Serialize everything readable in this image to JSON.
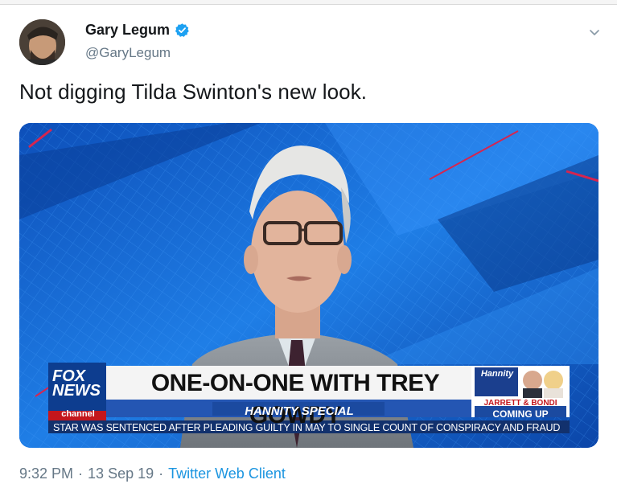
{
  "tweet": {
    "display_name": "Gary Legum",
    "handle": "@GaryLegum",
    "text": "Not digging Tilda Swinton's new look.",
    "time": "9:32 PM",
    "date": "13 Sep 19",
    "client": "Twitter Web Client",
    "separator": "·"
  },
  "icons": {
    "verified": "verified-badge-icon",
    "caret": "chevron-down-icon"
  },
  "media": {
    "network": "FOX NEWS",
    "network_sub": "channel",
    "headline": "ONE-ON-ONE WITH TREY GOWDY",
    "show": "HANNITY SPECIAL",
    "show_logo": "Hannity",
    "promo_names": "JARRETT & BONDI",
    "promo_status": "COMING UP",
    "ticker": "STAR WAS SENTENCED AFTER PLEADING GUILTY IN MAY TO SINGLE COUNT OF CONSPIRACY AND FRAUD"
  },
  "colors": {
    "accent": "#1da1f2",
    "link": "#1b95e0",
    "muted": "#657786",
    "text": "#14171a"
  }
}
